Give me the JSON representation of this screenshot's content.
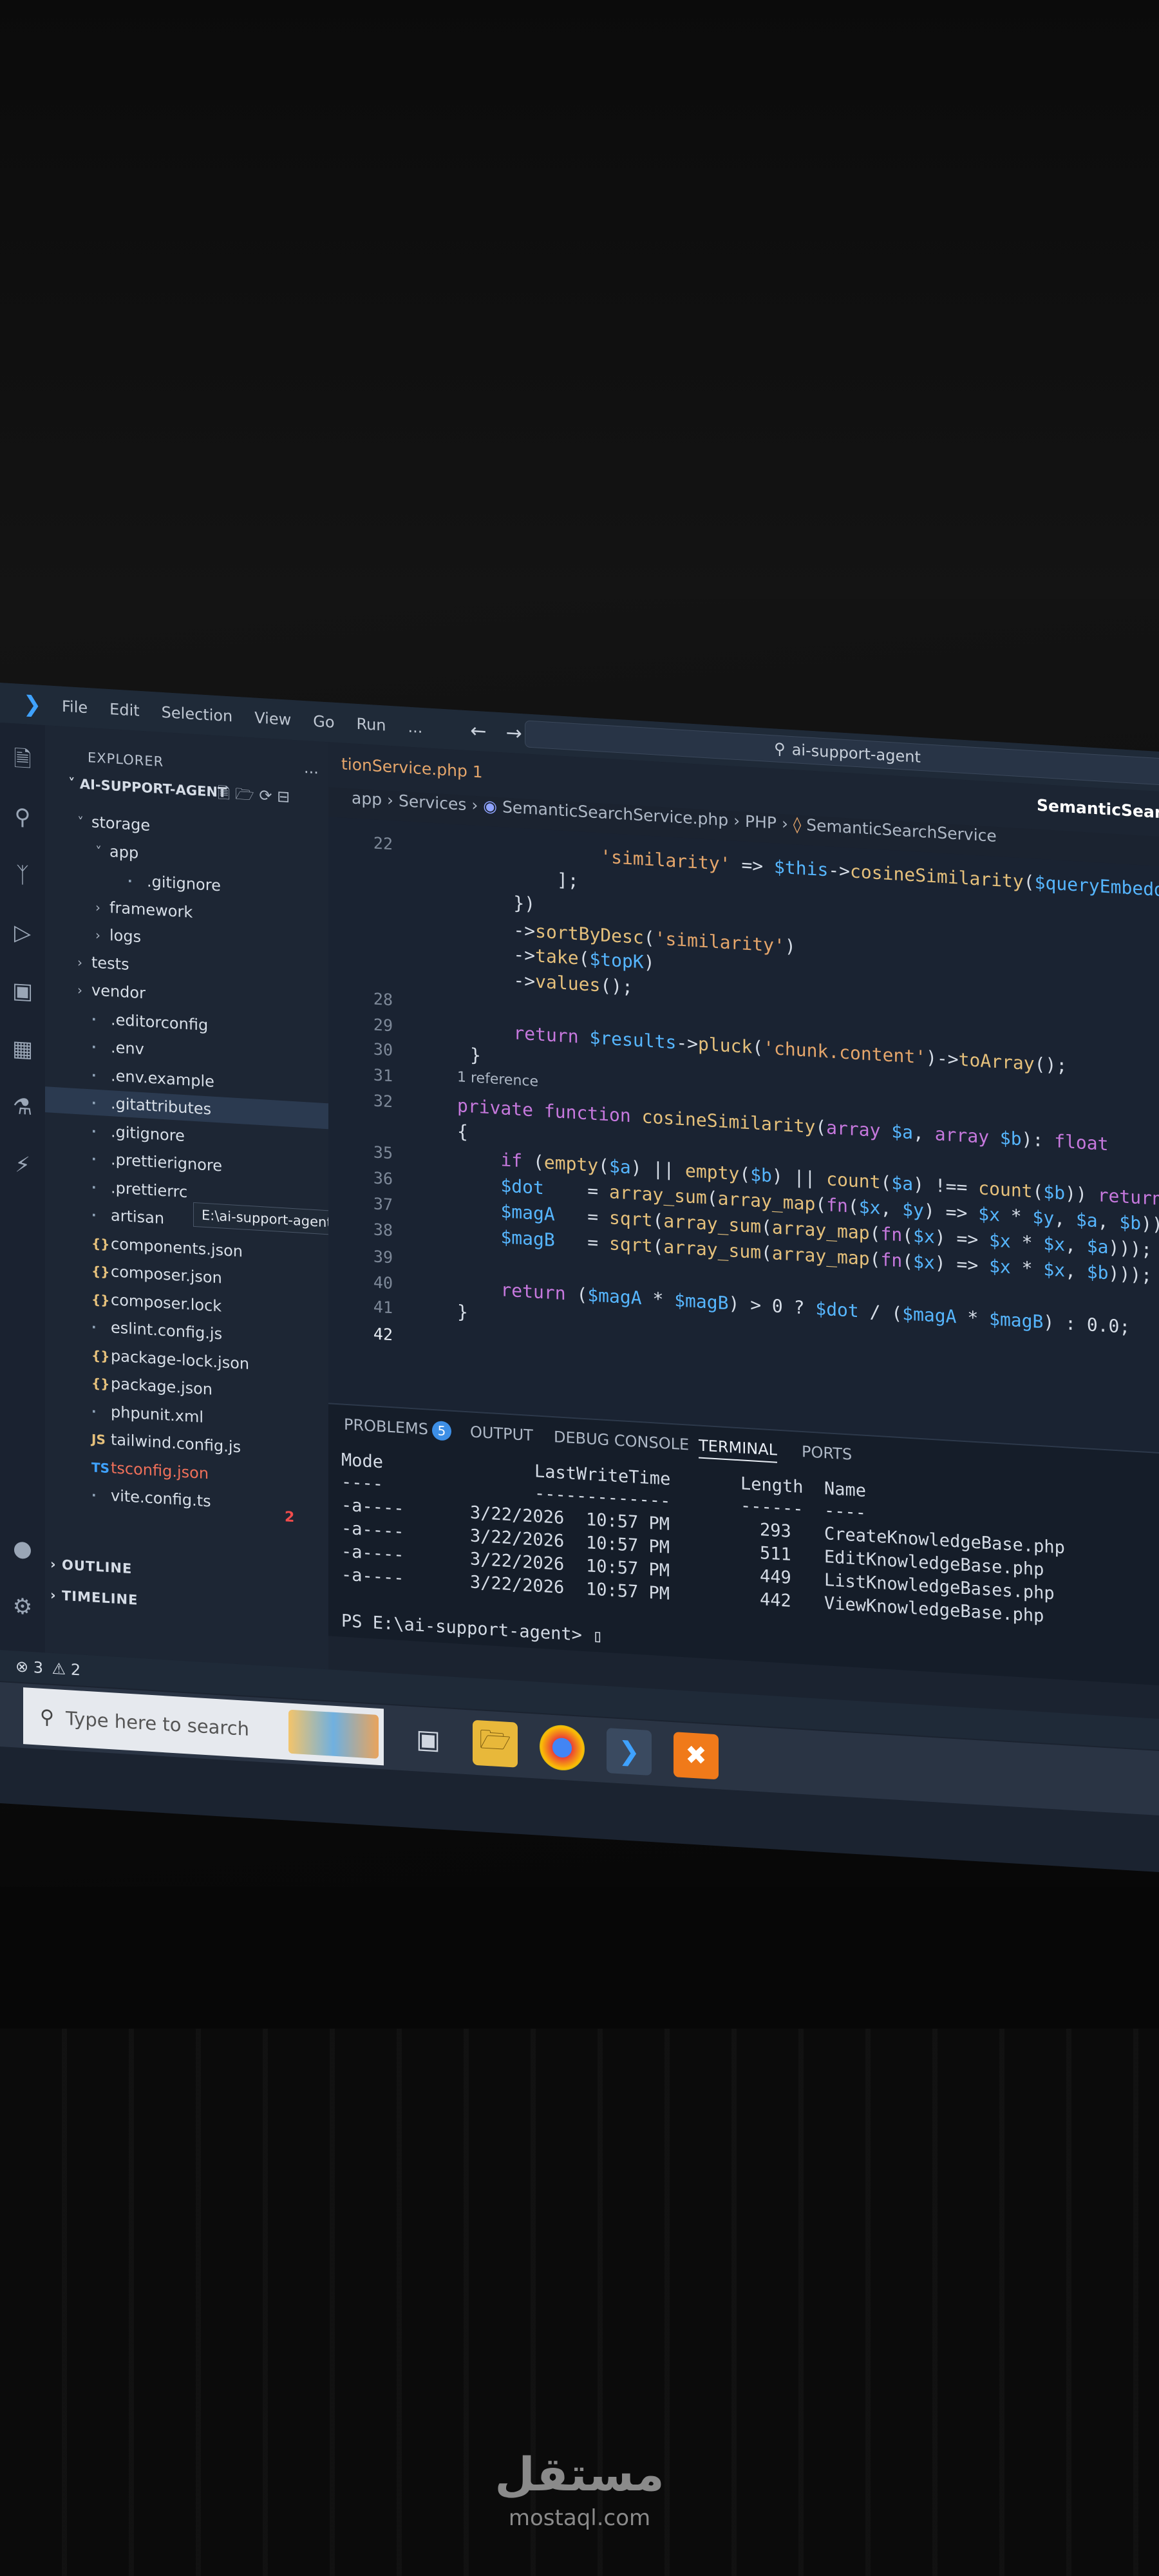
{
  "window": {
    "title": "ai-support-agent",
    "menu": [
      "File",
      "Edit",
      "Selection",
      "View",
      "Go",
      "Run",
      "..."
    ]
  },
  "explorer": {
    "header": "EXPLORER",
    "more": "...",
    "project": "AI-SUPPORT-AGENT",
    "tree": [
      {
        "label": "storage",
        "depth": 0,
        "kind": "folder-open"
      },
      {
        "label": "app",
        "depth": 1,
        "kind": "folder-open"
      },
      {
        "label": ".gitignore",
        "depth": 2,
        "kind": "file"
      },
      {
        "label": "framework",
        "depth": 1,
        "kind": "folder"
      },
      {
        "label": "logs",
        "depth": 1,
        "kind": "folder"
      },
      {
        "label": "tests",
        "depth": 0,
        "kind": "folder"
      },
      {
        "label": "vendor",
        "depth": 0,
        "kind": "folder"
      },
      {
        "label": ".editorconfig",
        "depth": 0,
        "kind": "file"
      },
      {
        "label": ".env",
        "depth": 0,
        "kind": "file"
      },
      {
        "label": ".env.example",
        "depth": 0,
        "kind": "file"
      },
      {
        "label": ".gitattributes",
        "depth": 0,
        "kind": "file"
      },
      {
        "label": ".gitignore",
        "depth": 0,
        "kind": "file"
      },
      {
        "label": ".prettierignore",
        "depth": 0,
        "kind": "file"
      },
      {
        "label": ".prettierrc",
        "depth": 0,
        "kind": "file"
      },
      {
        "label": "artisan",
        "depth": 0,
        "kind": "file"
      },
      {
        "label": "components.json",
        "depth": 0,
        "kind": "json"
      },
      {
        "label": "composer.json",
        "depth": 0,
        "kind": "json"
      },
      {
        "label": "composer.lock",
        "depth": 0,
        "kind": "json"
      },
      {
        "label": "eslint.config.js",
        "depth": 0,
        "kind": "file"
      },
      {
        "label": "package-lock.json",
        "depth": 0,
        "kind": "json"
      },
      {
        "label": "package.json",
        "depth": 0,
        "kind": "json"
      },
      {
        "label": "phpunit.xml",
        "depth": 0,
        "kind": "file"
      },
      {
        "label": "tailwind.config.js",
        "depth": 0,
        "kind": "js"
      },
      {
        "label": "tsconfig.json",
        "depth": 0,
        "kind": "ts"
      },
      {
        "label": "vite.config.ts",
        "depth": 0,
        "kind": "file"
      }
    ],
    "tooltip": "E:\\ai-support-agent\\.gitattributes",
    "tsconfig_badge": "2",
    "outline": "OUTLINE",
    "timeline": "TIMELINE"
  },
  "tabs": [
    {
      "label": "tionService.php 1",
      "state": "modified"
    },
    {
      "label": "SemanticSearch"
    }
  ],
  "breadcrumb": [
    "app",
    "Services",
    "SemanticSearchService.php",
    "PHP",
    "SemanticSearchService"
  ],
  "editor": {
    "reference_hint": "1 reference",
    "lines": [
      {
        "n": "22",
        "code": "            'similarity' => $this->cosineSimilarity($queryEmbeddi"
      },
      {
        "n": "",
        "code": "        ];"
      },
      {
        "n": "",
        "code": "    })"
      },
      {
        "n": "",
        "code": "    ->sortByDesc('similarity')"
      },
      {
        "n": "",
        "code": "    ->take($topK)"
      },
      {
        "n": "",
        "code": "    ->values();"
      },
      {
        "n": "28",
        "code": ""
      },
      {
        "n": "29",
        "code": "    return $results->pluck('chunk.content')->toArray();"
      },
      {
        "n": "30",
        "code": "}"
      },
      {
        "n": "31",
        "code": ""
      },
      {
        "n": "32",
        "code": "private function cosineSimilarity(array $a, array $b): float"
      },
      {
        "n": "",
        "code": "{"
      },
      {
        "n": "35",
        "code": "    if (empty($a) || empty($b) || count($a) !== count($b)) return"
      },
      {
        "n": "36",
        "code": "    $dot    = array_sum(array_map(fn($x, $y) => $x * $y, $a, $b));"
      },
      {
        "n": "37",
        "code": "    $magA   = sqrt(array_sum(array_map(fn($x) => $x * $x, $a)));"
      },
      {
        "n": "38",
        "code": "    $magB   = sqrt(array_sum(array_map(fn($x) => $x * $x, $b)));"
      },
      {
        "n": "39",
        "code": ""
      },
      {
        "n": "40",
        "code": "    return ($magA * $magB) > 0 ? $dot / ($magA * $magB) : 0.0;"
      },
      {
        "n": "41",
        "code": "}"
      },
      {
        "n": "42",
        "code": ""
      }
    ]
  },
  "panel": {
    "tabs": [
      "PROBLEMS",
      "OUTPUT",
      "DEBUG CONSOLE",
      "TERMINAL",
      "PORTS"
    ],
    "problems_count": "5",
    "active_tab": "TERMINAL",
    "terminal": {
      "headers": [
        "Mode",
        "LastWriteTime",
        "Length",
        "Name"
      ],
      "underline": [
        "----",
        "-------------",
        "------",
        "----"
      ],
      "rows": [
        {
          "mode": "-a----",
          "date": "3/22/2026",
          "time": "10:57 PM",
          "length": "293",
          "name": "CreateKnowledgeBase.php"
        },
        {
          "mode": "-a----",
          "date": "3/22/2026",
          "time": "10:57 PM",
          "length": "511",
          "name": "EditKnowledgeBase.php"
        },
        {
          "mode": "-a----",
          "date": "3/22/2026",
          "time": "10:57 PM",
          "length": "449",
          "name": "ListKnowledgeBases.php"
        },
        {
          "mode": "-a----",
          "date": "3/22/2026",
          "time": "10:57 PM",
          "length": "442",
          "name": "ViewKnowledgeBase.php"
        }
      ],
      "prompt": "PS E:\\ai-support-agent> "
    }
  },
  "statusbar": {
    "errors": "3",
    "warnings": "2"
  },
  "taskbar": {
    "search_placeholder": "Type here to search"
  },
  "watermark": {
    "arabic": "مستقل",
    "latin": "mostaql.com"
  },
  "colors": {
    "accent": "#3fa2ff",
    "error": "#f14c4c",
    "keyword": "#c678dd",
    "function": "#e5c07b",
    "variable": "#56b6ff",
    "string": "#e5a66b"
  }
}
